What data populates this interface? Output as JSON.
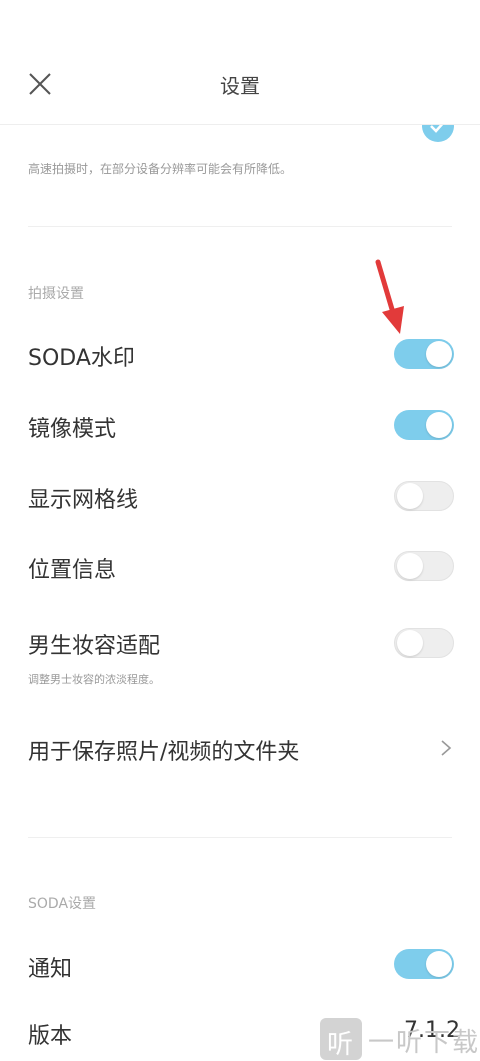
{
  "header": {
    "title": "设置",
    "close_icon": "close-icon"
  },
  "top_hint": "高速拍摄时，在部分设备分辨率可能会有所降低。",
  "shooting_section": {
    "title": "拍摄设置",
    "items": [
      {
        "label": "SODA水印",
        "enabled": true
      },
      {
        "label": "镜像模式",
        "enabled": true
      },
      {
        "label": "显示网格线",
        "enabled": false
      },
      {
        "label": "位置信息",
        "enabled": false
      },
      {
        "label": "男生妆容适配",
        "enabled": false,
        "hint": "调整男士妆容的浓淡程度。"
      }
    ],
    "folder_link": "用于保存照片/视频的文件夹"
  },
  "soda_section": {
    "title": "SODA设置",
    "notification_label": "通知",
    "notification_enabled": true,
    "version_label": "版本",
    "version_value": "7.1.2"
  },
  "watermark": {
    "icon_char": "听",
    "text": "一听下载"
  },
  "colors": {
    "toggle_on": "#7ecdec",
    "toggle_off": "#eeeeee",
    "arrow": "#e23a3a"
  }
}
